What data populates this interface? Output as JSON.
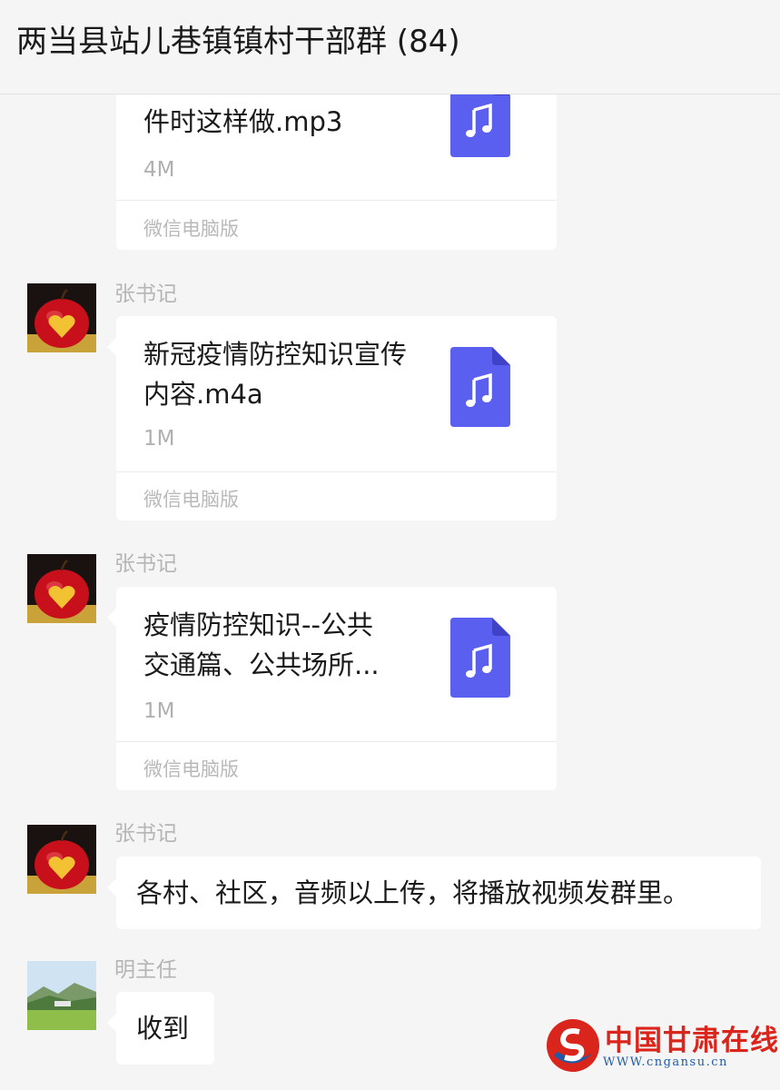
{
  "header": {
    "title": "两当县站儿巷镇镇村干部群 (84)"
  },
  "messages": [
    {
      "type": "file",
      "name": "件时这样做.mp3",
      "size": "4M",
      "source": "微信电脑版",
      "icon": "music-file-icon"
    },
    {
      "type": "file",
      "sender": "张书记",
      "avatar": "apple-heart-avatar",
      "name": "新冠疫情防控知识宣传内容.m4a",
      "size": "1M",
      "source": "微信电脑版",
      "icon": "music-file-icon"
    },
    {
      "type": "file",
      "sender": "张书记",
      "avatar": "apple-heart-avatar",
      "name_line1": "疫情防控知识--公共",
      "name_line2": "交通篇、公共场所...",
      "size": "1M",
      "source": "微信电脑版",
      "icon": "music-file-icon"
    },
    {
      "type": "text",
      "sender": "张书记",
      "avatar": "apple-heart-avatar",
      "text": "各村、社区，音频以上传，将播放视频发群里。"
    },
    {
      "type": "text",
      "sender": "明主任",
      "avatar": "landscape-avatar",
      "text": "收到"
    }
  ],
  "watermark": {
    "text": "中国甘肃在线",
    "url": "WWW.cngansu.cn"
  },
  "colors": {
    "background": "#f5f5f5",
    "bubble": "#ffffff",
    "file_icon": "#5b5ff0",
    "watermark_red": "#d9251c",
    "watermark_blue": "#1f5aa8"
  }
}
